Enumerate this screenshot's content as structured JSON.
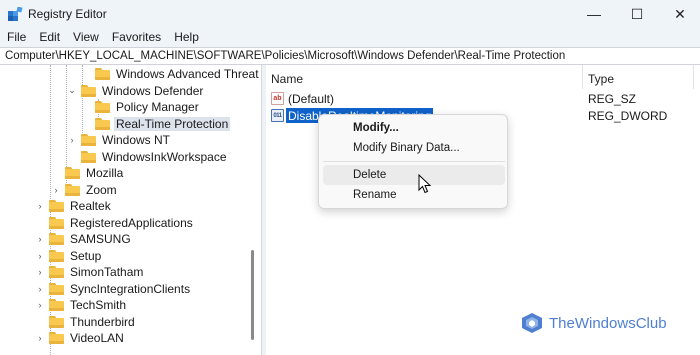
{
  "window": {
    "title": "Registry Editor"
  },
  "controls": {
    "minimize": "—",
    "maximize": "☐",
    "close": "✕"
  },
  "menu": [
    "File",
    "Edit",
    "View",
    "Favorites",
    "Help"
  ],
  "address": "Computer\\HKEY_LOCAL_MACHINE\\SOFTWARE\\Policies\\Microsoft\\Windows Defender\\Real-Time Protection",
  "tree": [
    {
      "label": "Windows Advanced Threat",
      "expander": "",
      "selected": false
    },
    {
      "label": "Windows Defender",
      "expander": "⌄",
      "selected": false
    },
    {
      "label": "Policy Manager",
      "expander": "",
      "selected": false
    },
    {
      "label": "Real-Time Protection",
      "expander": "",
      "selected": true
    },
    {
      "label": "Windows NT",
      "expander": "›",
      "selected": false
    },
    {
      "label": "WindowsInkWorkspace",
      "expander": "",
      "selected": false
    },
    {
      "label": "Mozilla",
      "expander": "",
      "selected": false
    },
    {
      "label": "Zoom",
      "expander": "›",
      "selected": false
    },
    {
      "label": "Realtek",
      "expander": "›",
      "selected": false
    },
    {
      "label": "RegisteredApplications",
      "expander": "",
      "selected": false
    },
    {
      "label": "SAMSUNG",
      "expander": "›",
      "selected": false
    },
    {
      "label": "Setup",
      "expander": "›",
      "selected": false
    },
    {
      "label": "SimonTatham",
      "expander": "›",
      "selected": false
    },
    {
      "label": "SyncIntegrationClients",
      "expander": "›",
      "selected": false
    },
    {
      "label": "TechSmith",
      "expander": "›",
      "selected": false
    },
    {
      "label": "Thunderbird",
      "expander": "",
      "selected": false
    },
    {
      "label": "VideoLAN",
      "expander": "›",
      "selected": false
    }
  ],
  "list": {
    "columns": [
      "Name",
      "Type"
    ],
    "rows": [
      {
        "name": "(Default)",
        "type": "REG_SZ",
        "icon": "string-value-icon",
        "icon_text": "ab",
        "selected": false
      },
      {
        "name": "DisableRealtimeMonitoring",
        "type": "REG_DWORD",
        "icon": "binary-value-icon",
        "icon_text": "011",
        "selected": true
      }
    ]
  },
  "context_menu": [
    {
      "label": "Modify...",
      "bold": true,
      "hover": false
    },
    {
      "label": "Modify Binary Data...",
      "bold": false,
      "hover": false
    },
    {
      "label": "Delete",
      "bold": false,
      "hover": true
    },
    {
      "label": "Rename",
      "bold": false,
      "hover": false
    }
  ],
  "watermark": {
    "text": "TheWindowsClub"
  },
  "colors": {
    "selection": "#0f62c9",
    "folder": "#f8c94e",
    "watermark": "#4f7fcf"
  }
}
